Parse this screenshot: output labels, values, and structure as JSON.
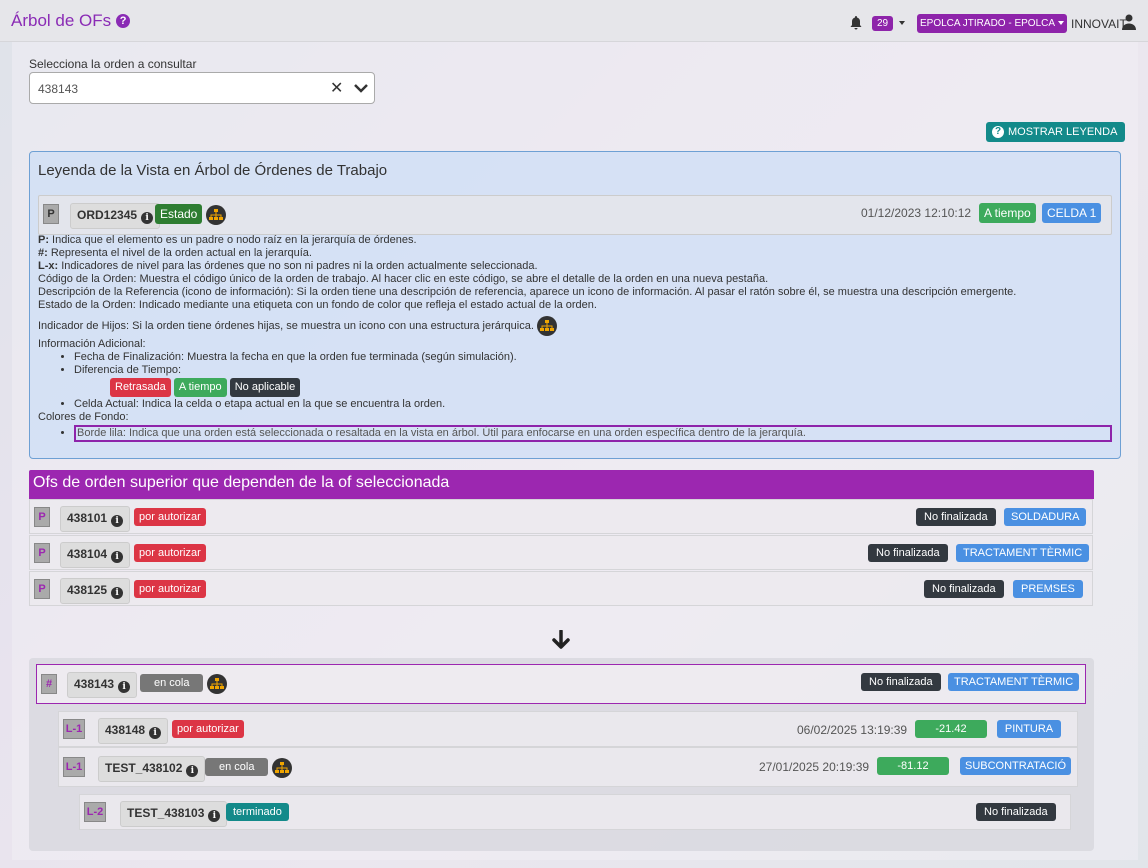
{
  "header": {
    "title": "Árbol de OFs",
    "notifications": "29",
    "user": "EPOLCA JTIRADO - EPOLCA",
    "company": "INNOVAIT"
  },
  "selector": {
    "label": "Selecciona la orden a consultar",
    "value": "438143"
  },
  "legend_button": "MOSTRAR LEYENDA",
  "legend": {
    "title": "Leyenda de la Vista en Árbol de Órdenes de Trabajo",
    "sample": {
      "level": "P",
      "code": "ORD12345",
      "state": "Estado",
      "date": "01/12/2023 12:10:12",
      "time": "A tiempo",
      "cell": "CELDA 1"
    },
    "lines": [
      {
        "b": "P:",
        "t": " Indica que el elemento es un padre o nodo raíz en la jerarquía de órdenes."
      },
      {
        "b": "#:",
        "t": " Representa el nivel de la orden actual en la jerarquía."
      },
      {
        "b": "L-x:",
        "t": " Indicadores de nivel para las órdenes que no son ni padres ni la orden actualmente seleccionada."
      },
      {
        "b": "",
        "t": "Código de la Orden: Muestra el código único de la orden de trabajo. Al hacer clic en este código, se abre el detalle de la orden en una nueva pestaña."
      },
      {
        "b": "",
        "t": "Descripción de la Referencia (icono de información): Si la orden tiene una descripción de referencia, aparece un icono de información. Al pasar el ratón sobre él, se muestra una descripción emergente."
      },
      {
        "b": "",
        "t": "Estado de la Orden: Indicado mediante una etiqueta con un fondo de color que refleja el estado actual de la orden."
      }
    ],
    "children_indicator": "Indicador de Hijos: Si la orden tiene órdenes hijas, se muestra un icono con una estructura jerárquica.",
    "additional_info": "Información Adicional:",
    "finish_date": "Fecha de Finalización: Muestra la fecha en que la orden fue terminada (según simulación).",
    "time_diff": "Diferencia de Tiempo:",
    "diff_badges": [
      "Retrasada",
      "A tiempo",
      "No aplicable"
    ],
    "current_cell": "Celda Actual: Indica la celda o etapa actual en la que se encuentra la orden.",
    "bg_colors": "Colores de Fondo:",
    "purple_border": "Borde lila: Indica que una orden está seleccionada o resaltada en la vista en árbol. Útil para enfocarse en una orden específica dentro de la jerarquía."
  },
  "parents": {
    "title": "Ofs de orden superior que dependen de la of seleccionada",
    "rows": [
      {
        "level": "P",
        "code": "438101",
        "state": "por autorizar",
        "status": "No finalizada",
        "cell": "SOLDADURA"
      },
      {
        "level": "P",
        "code": "438104",
        "state": "por autorizar",
        "status": "No finalizada",
        "cell": "TRACTAMENT TÈRMIC"
      },
      {
        "level": "P",
        "code": "438125",
        "state": "por autorizar",
        "status": "No finalizada",
        "cell": "PREMSES"
      }
    ]
  },
  "current": {
    "level": "#",
    "code": "438143",
    "state": "en cola",
    "status": "No finalizada",
    "cell": "TRACTAMENT TÈRMIC"
  },
  "children": [
    {
      "level": "L-1",
      "code": "438148",
      "state": "por autorizar",
      "date": "06/02/2025 13:19:39",
      "diff": "-21.42",
      "cell": "PINTURA"
    },
    {
      "level": "L-1",
      "code": "TEST_438102",
      "state": "en cola",
      "date": "27/01/2025 20:19:39",
      "diff": "-81.12",
      "cell": "SUBCONTRATACIÓ"
    },
    {
      "level": "L-2",
      "code": "TEST_438103",
      "state": "terminado",
      "status": "No finalizada"
    }
  ],
  "colors": {
    "accent": "#9c27b0",
    "teal": "#138a8a",
    "danger": "#dc3545"
  }
}
